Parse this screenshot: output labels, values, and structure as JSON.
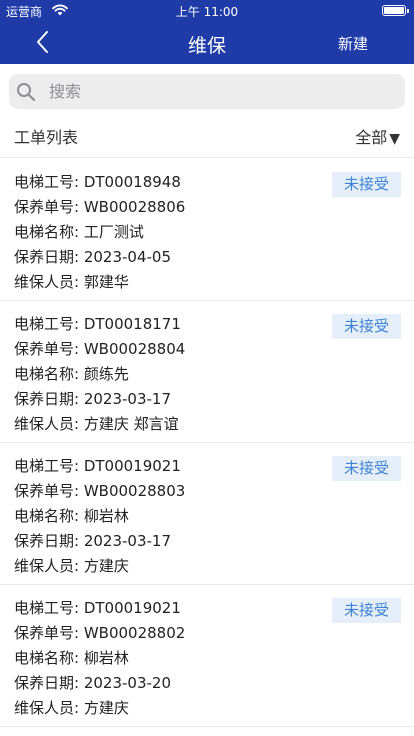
{
  "status_bar": {
    "carrier": "运营商",
    "time": "上午 11:00"
  },
  "nav": {
    "title": "维保",
    "action_label": "新建"
  },
  "search": {
    "placeholder": "搜索"
  },
  "list": {
    "title": "工单列表",
    "filter_label": "全部",
    "filter_caret": "▼"
  },
  "orders": [
    {
      "elevator_no": "电梯工号: DT00018948",
      "maintenance_no": "保养单号: WB00028806",
      "elevator_name": "电梯名称: 工厂测试",
      "date": "保养日期: 2023-04-05",
      "staff": "维保人员: 郭建华",
      "status": "未接受"
    },
    {
      "elevator_no": "电梯工号: DT00018171",
      "maintenance_no": "保养单号: WB00028804",
      "elevator_name": "电梯名称: 颜练先",
      "date": "保养日期: 2023-03-17",
      "staff": "维保人员: 方建庆  郑言谊",
      "status": "未接受"
    },
    {
      "elevator_no": "电梯工号: DT00019021",
      "maintenance_no": "保养单号: WB00028803",
      "elevator_name": "电梯名称: 柳岩林",
      "date": "保养日期: 2023-03-17",
      "staff": "维保人员: 方建庆",
      "status": "未接受"
    },
    {
      "elevator_no": "电梯工号: DT00019021",
      "maintenance_no": "保养单号: WB00028802",
      "elevator_name": "电梯名称: 柳岩林",
      "date": "保养日期: 2023-03-20",
      "staff": "维保人员: 方建庆",
      "status": "未接受"
    }
  ],
  "colors": {
    "header": "#1e3ba8",
    "badge_bg": "#e6eef9",
    "badge_text": "#3b83d6"
  }
}
